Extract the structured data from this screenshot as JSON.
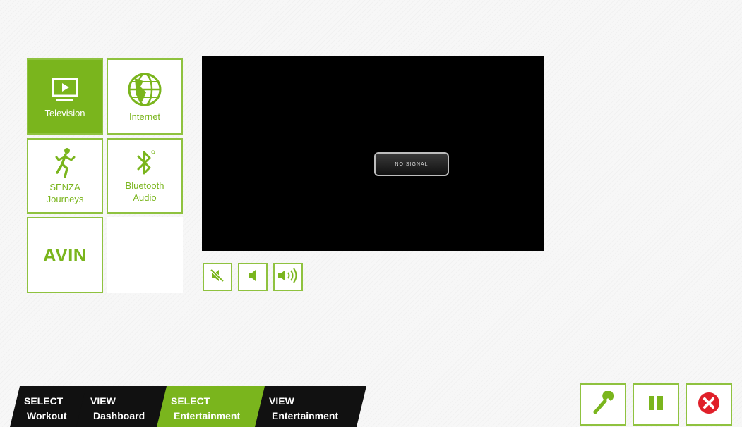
{
  "sources": {
    "television": {
      "label": "Television",
      "icon": "tv-icon"
    },
    "internet": {
      "label": "Internet",
      "icon": "globe-icon"
    },
    "senza": {
      "label_line1": "SENZA",
      "label_line2": "Journeys",
      "icon": "runner-icon"
    },
    "bluetooth": {
      "label_line1": "Bluetooth",
      "label_line2": "Audio",
      "icon": "bluetooth-icon"
    },
    "avin": {
      "label": "AVIN"
    }
  },
  "screen": {
    "status": "NO SIGNAL"
  },
  "volume": {
    "icons": [
      "mute-icon",
      "volume-down-icon",
      "volume-up-icon"
    ]
  },
  "nav": [
    {
      "line1": "SELECT",
      "line2": "Workout",
      "active": false
    },
    {
      "line1": "VIEW",
      "line2": "Dashboard",
      "active": false
    },
    {
      "line1": "SELECT",
      "line2": "Entertainment",
      "active": true
    },
    {
      "line1": "VIEW",
      "line2": "Entertainment",
      "active": false
    }
  ],
  "controls": {
    "icons": [
      "wrench-icon",
      "pause-icon",
      "close-icon"
    ]
  },
  "colors": {
    "accent": "#7ab51d",
    "border": "#8fc23f",
    "nav_dark": "#111111",
    "close_red": "#e0202a"
  }
}
